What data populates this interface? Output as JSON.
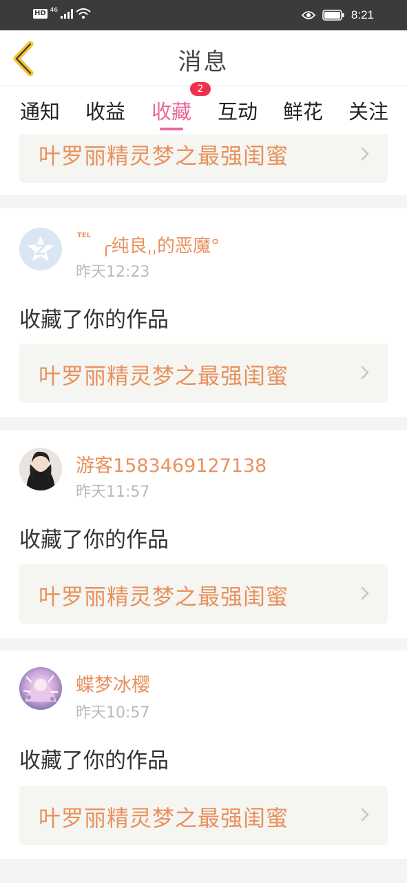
{
  "status_bar": {
    "hd": "HD",
    "network": "46",
    "time": "8:21"
  },
  "header": {
    "title": "消息"
  },
  "tabs": [
    {
      "label": "通知"
    },
    {
      "label": "收益"
    },
    {
      "label": "收藏",
      "active": true,
      "badge": "2"
    },
    {
      "label": "互动"
    },
    {
      "label": "鲜花"
    },
    {
      "label": "关注"
    }
  ],
  "colors": {
    "accent": "#e7689c",
    "orange_text": "#e8915e",
    "badge": "#f0314b"
  },
  "partial_card": {
    "work_title": "叶罗丽精灵梦之最强闺蜜"
  },
  "items": [
    {
      "user_prefix": "TEL",
      "username": "╭纯良ˌˌ的恶魔°",
      "time": "昨天12:23",
      "action": "收藏了你的作品",
      "work_title": "叶罗丽精灵梦之最强闺蜜",
      "avatar_icon": "default-avatar-icon"
    },
    {
      "username": "游客1583469127138",
      "time": "昨天11:57",
      "action": "收藏了你的作品",
      "work_title": "叶罗丽精灵梦之最强闺蜜",
      "avatar_icon": "user-photo-avatar"
    },
    {
      "username": "蝶梦冰樱",
      "time": "昨天10:57",
      "action": "收藏了你的作品",
      "work_title": "叶罗丽精灵梦之最强闺蜜",
      "avatar_icon": "user-anime-avatar"
    }
  ]
}
